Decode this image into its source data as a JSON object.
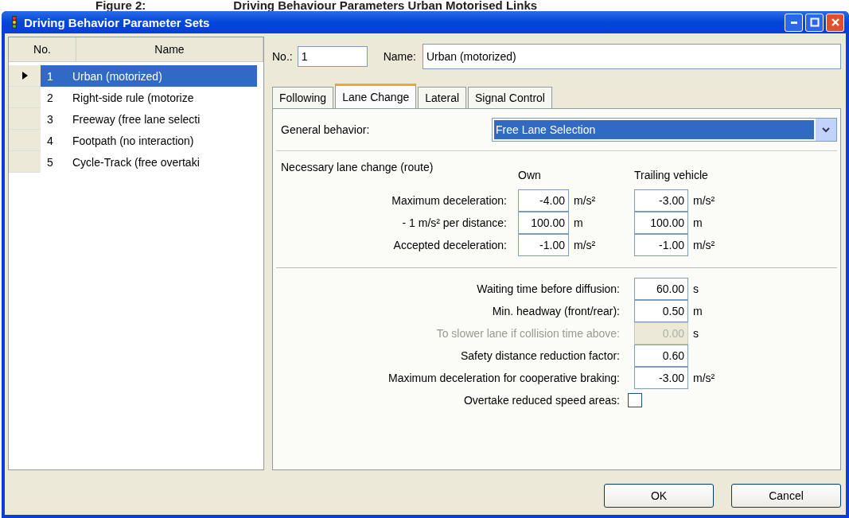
{
  "caption": {
    "label": "Figure 2:",
    "title": "Driving Behaviour Parameters Urban Motorised Links"
  },
  "window": {
    "title": "Driving Behavior Parameter Sets"
  },
  "list": {
    "columns": [
      "No.",
      "Name"
    ],
    "rows": [
      {
        "no": "1",
        "name": "Urban (motorized)",
        "selected": true
      },
      {
        "no": "2",
        "name": "Right-side rule (motorize",
        "selected": false
      },
      {
        "no": "3",
        "name": "Freeway (free lane selecti",
        "selected": false
      },
      {
        "no": "4",
        "name": "Footpath (no interaction)",
        "selected": false
      },
      {
        "no": "5",
        "name": "Cycle-Track (free overtaki",
        "selected": false
      }
    ]
  },
  "header": {
    "no_label": "No.:",
    "no_value": "1",
    "name_label": "Name:",
    "name_value": "Urban (motorized)"
  },
  "tabs": [
    {
      "label": "Following",
      "selected": false
    },
    {
      "label": "Lane Change",
      "selected": true
    },
    {
      "label": "Lateral",
      "selected": false
    },
    {
      "label": "Signal Control",
      "selected": false
    }
  ],
  "general_behavior": {
    "label": "General behavior:",
    "value": "Free Lane Selection"
  },
  "route": {
    "title": "Necessary lane change (route)",
    "columns": [
      "Own",
      "Trailing vehicle"
    ],
    "rows": [
      {
        "label": "Maximum deceleration:",
        "own": "-4.00",
        "own_unit": "m/s²",
        "trailing": "-3.00",
        "trailing_unit": "m/s²"
      },
      {
        "label": "- 1 m/s² per distance:",
        "own": "100.00",
        "own_unit": "m",
        "trailing": "100.00",
        "trailing_unit": "m"
      },
      {
        "label": "Accepted deceleration:",
        "own": "-1.00",
        "own_unit": "m/s²",
        "trailing": "-1.00",
        "trailing_unit": "m/s²"
      }
    ]
  },
  "parameters": [
    {
      "kind": "field",
      "label": "Waiting time before diffusion:",
      "value": "60.00",
      "unit": "s",
      "disabled": false
    },
    {
      "kind": "field",
      "label": "Min. headway (front/rear):",
      "value": "0.50",
      "unit": "m",
      "disabled": false
    },
    {
      "kind": "field",
      "label": "To slower lane if collision time above:",
      "value": "0.00",
      "unit": "s",
      "disabled": true
    },
    {
      "kind": "field",
      "label": "Safety distance reduction factor:",
      "value": "0.60",
      "disabled": false
    },
    {
      "kind": "field",
      "label": "Maximum deceleration for cooperative braking:",
      "value": "-3.00",
      "unit": "m/s²",
      "disabled": false
    },
    {
      "kind": "checkbox",
      "label": "Overtake reduced speed areas:",
      "checked": false
    }
  ],
  "buttons": [
    "OK",
    "Cancel"
  ]
}
